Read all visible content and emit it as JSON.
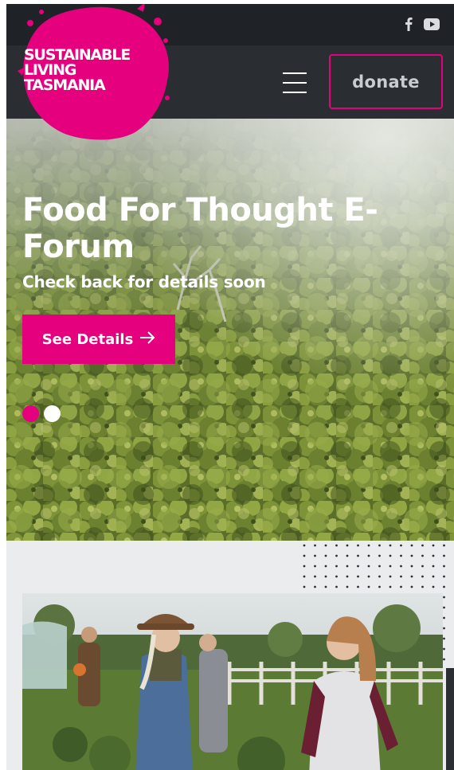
{
  "brand": {
    "logo_lines": [
      "SUSTAINABLE",
      "LIVING",
      "TASMANIA"
    ],
    "accent_color": "#e5007e"
  },
  "header": {
    "social_icons": [
      "facebook-icon",
      "youtube-icon"
    ],
    "menu_icon": "hamburger-menu-icon",
    "donate_label": "donate"
  },
  "hero": {
    "title": "Food For Thought E-Forum",
    "subtitle": "Check back for details soon",
    "button_label": "See Details",
    "button_icon": "arrow-right-icon",
    "slides_total": 2,
    "active_slide": 1
  }
}
